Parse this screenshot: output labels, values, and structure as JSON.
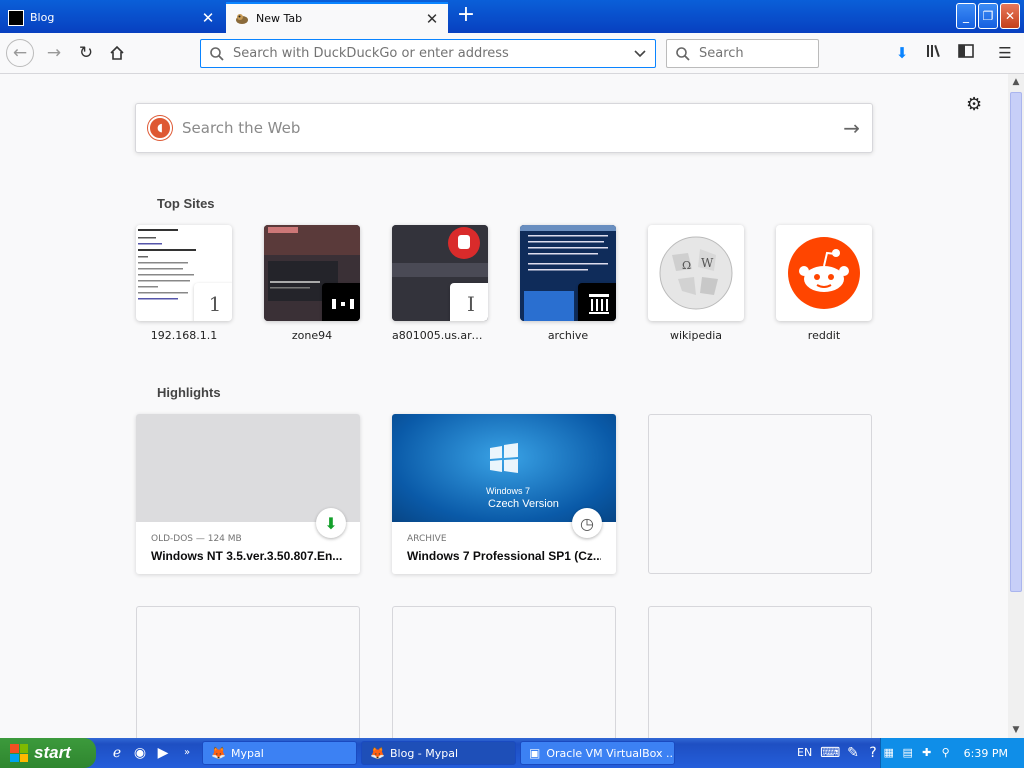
{
  "tabs": [
    {
      "label": "Blog",
      "active": false
    },
    {
      "label": "New Tab",
      "active": true
    }
  ],
  "navbar": {
    "url_placeholder": "Search with DuckDuckGo or enter address",
    "search_placeholder": "Search"
  },
  "newtab": {
    "web_search_placeholder": "Search the Web",
    "top_sites_title": "Top Sites",
    "top_sites": [
      {
        "label": "192.168.1.1",
        "badge": "1"
      },
      {
        "label": "zone94",
        "badge": ""
      },
      {
        "label": "a801005.us.archi...",
        "badge": "I"
      },
      {
        "label": "archive",
        "badge": ""
      },
      {
        "label": "wikipedia",
        "badge": ""
      },
      {
        "label": "reddit",
        "badge": ""
      }
    ],
    "highlights_title": "Highlights",
    "highlights": [
      {
        "context": "OLD-DOS — 124 MB",
        "title": "Windows NT 3.5.ver.3.50.807.En...",
        "image_text_1": "",
        "image_text_2": ""
      },
      {
        "context": "ARCHIVE",
        "title": "Windows 7 Professional SP1 (Cz...",
        "image_text_1": "Windows 7",
        "image_text_2": "Czech Version"
      }
    ]
  },
  "taskbar": {
    "start_label": "start",
    "buttons": [
      {
        "label": "Mypal"
      },
      {
        "label": "Blog - Mypal"
      },
      {
        "label": "Oracle VM VirtualBox ..."
      }
    ],
    "language": "EN",
    "clock": "6:39 PM"
  }
}
